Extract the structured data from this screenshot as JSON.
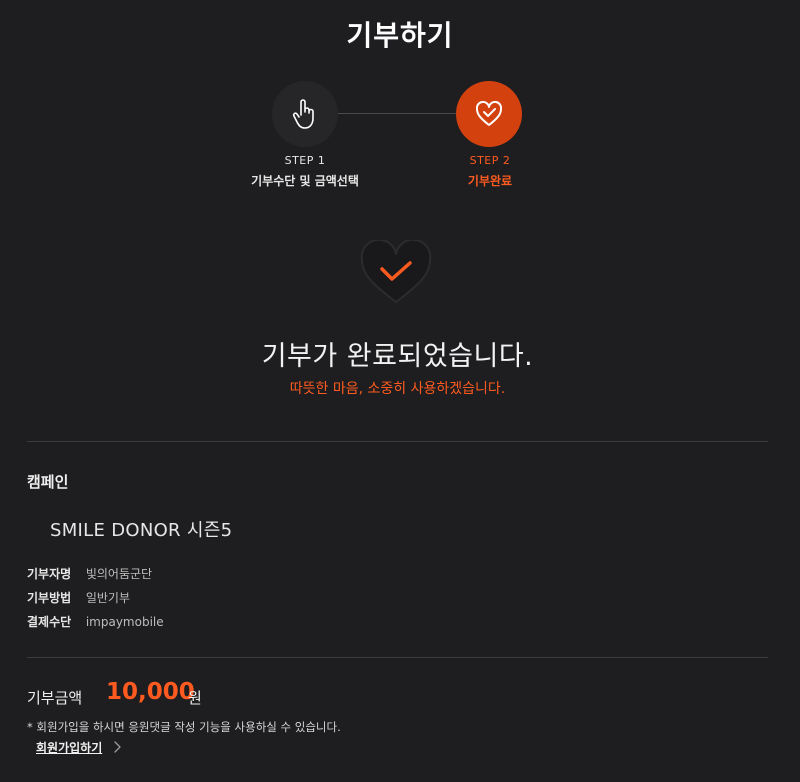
{
  "header": {
    "title": "기부하기"
  },
  "steps": [
    {
      "label": "STEP 1",
      "name": "기부수단 및 금액선택",
      "icon": "hand-pointer-icon",
      "state": "done"
    },
    {
      "label": "STEP 2",
      "name": "기부완료",
      "icon": "heart-check-icon",
      "state": "active"
    }
  ],
  "completion": {
    "title": "기부가 완료되었습니다.",
    "subtitle": "따뜻한 마음, 소중히 사용하겠습니다.",
    "icon": "heart-check-icon"
  },
  "campaign": {
    "section_label": "캠페인",
    "name": "SMILE DONOR 시즌5",
    "details": [
      {
        "key": "기부자명",
        "value": "빛의어둠군단"
      },
      {
        "key": "기부방법",
        "value": "일반기부"
      },
      {
        "key": "결제수단",
        "value": "impaymobile"
      }
    ]
  },
  "amount": {
    "label": "기부금액",
    "value": "10,000",
    "unit": "원"
  },
  "footer": {
    "notice": "* 회원가입을 하시면 응원댓글 작성 기능을 사용하실 수 있습니다.",
    "signup_label": "회원가입하기"
  },
  "colors": {
    "accent": "#ff5a1f",
    "step_active_bg": "#d3410f",
    "background": "#1e1e20"
  }
}
